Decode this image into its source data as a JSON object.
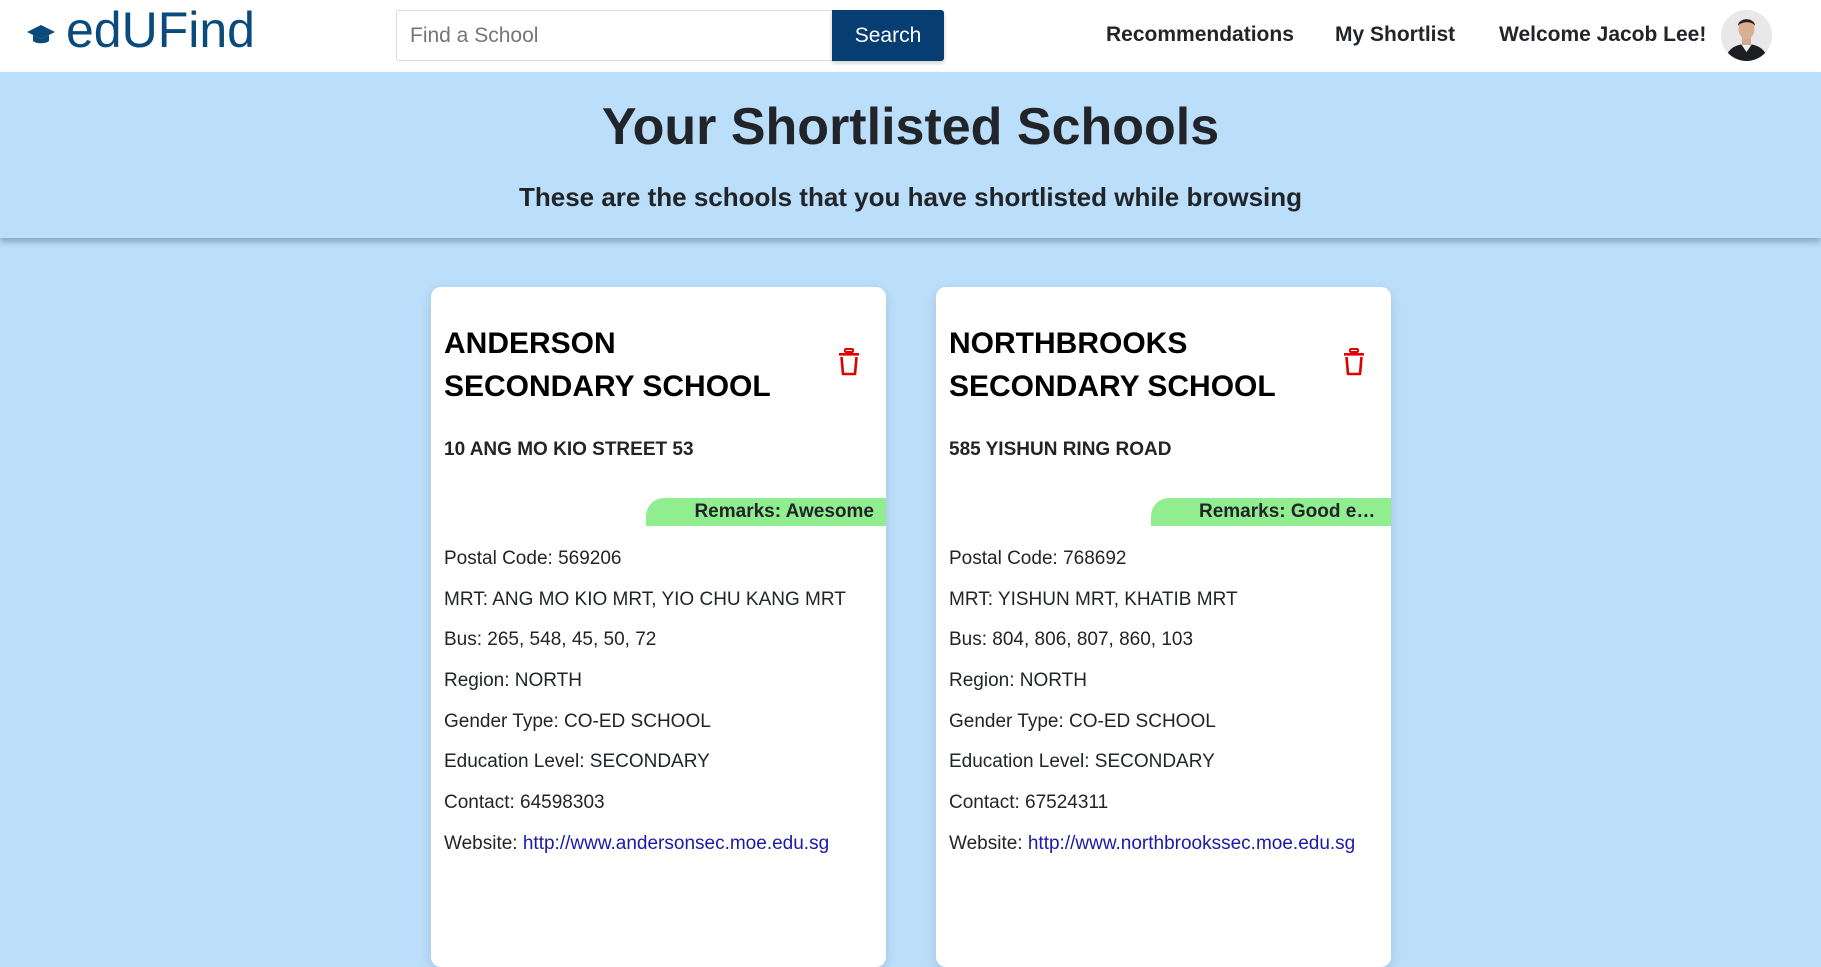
{
  "navbar": {
    "brand": "edUFind",
    "brand_icon": "graduation-cap-icon",
    "search_placeholder": "Find a School",
    "search_value": "",
    "search_button": "Search",
    "links": {
      "recommendations": "Recommendations",
      "shortlist": "My Shortlist",
      "welcome": "Welcome Jacob Lee!"
    }
  },
  "hero": {
    "title": "Your Shortlisted Schools",
    "subtitle": "These are the schools that you have shortlisted while browsing"
  },
  "colors": {
    "brand": "#0a4a7c",
    "search_button": "#063d73",
    "background": "#bbdefb",
    "remarks_badge": "#90ee90",
    "delete_icon": "#e00000",
    "link": "#1a1aa6"
  },
  "schools": [
    {
      "name": "ANDERSON SECONDARY SCHOOL",
      "address": "10 ANG MO KIO STREET 53",
      "remarks": "Remarks: Awesome",
      "postal": "Postal Code: 569206",
      "mrt": "MRT: ANG MO KIO MRT, YIO CHU KANG MRT",
      "bus": "Bus: 265, 548, 45, 50, 72",
      "region": "Region: NORTH",
      "gender": "Gender Type: CO-ED SCHOOL",
      "level": "Education Level: SECONDARY",
      "contact": "Contact: 64598303",
      "website_label": "Website: ",
      "website": "http://www.andersonsec.moe.edu.sg"
    },
    {
      "name": "NORTHBROOKS SECONDARY SCHOOL",
      "address": "585 YISHUN RING ROAD",
      "remarks": "Remarks: Good envir...",
      "postal": "Postal Code: 768692",
      "mrt": "MRT: YISHUN MRT, KHATIB MRT",
      "bus": "Bus: 804, 806, 807, 860, 103",
      "region": "Region: NORTH",
      "gender": "Gender Type: CO-ED SCHOOL",
      "level": "Education Level: SECONDARY",
      "contact": "Contact: 67524311",
      "website_label": "Website: ",
      "website": "http://www.northbrookssec.moe.edu.sg"
    }
  ]
}
